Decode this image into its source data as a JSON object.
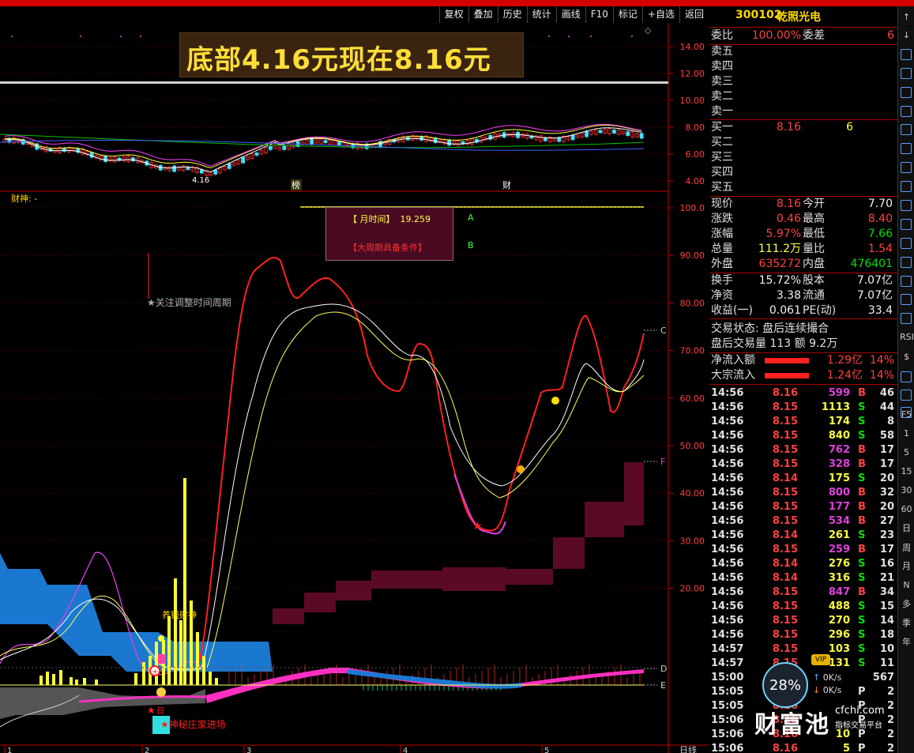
{
  "toolbar": [
    "复权",
    "叠加",
    "历史",
    "统计",
    "画线",
    "F10",
    "标记",
    "+自选",
    "返回"
  ],
  "stock": {
    "code": "300102",
    "name": "乾照光电"
  },
  "banner": "底部4.16元现在8.16元",
  "upper": {
    "yticks": [
      "14.00",
      "12.00",
      "10.00",
      "8.00",
      "6.00",
      "4.00"
    ],
    "low_label": "4.16",
    "tags": [
      "榜",
      "财"
    ]
  },
  "lower": {
    "title": "财神: -",
    "yticks": [
      "100.0",
      "90.00",
      "80.00",
      "70.00",
      "60.00",
      "50.00",
      "40.00",
      "30.00",
      "20.00"
    ],
    "box": {
      "a_label": "【 月时间】",
      "a_value": "19.259",
      "b_label": "【大周期具备条件】",
      "a_tag": "A",
      "b_tag": "B"
    },
    "note": "★关注调整时间周期",
    "right_tags": [
      "C",
      "F",
      "D",
      "E"
    ],
    "jiecai": "养钱财神",
    "zhuangjia": "★神秘庄家进场",
    "ri": "日",
    "xlabels": [
      "1",
      "2",
      "3",
      "4",
      "5"
    ],
    "period": "日线"
  },
  "quote": {
    "weibi_label": "委比",
    "weibi": "100.00%",
    "weicha_label": "委差",
    "weicha": "6",
    "sells": [
      "卖五",
      "卖四",
      "卖三",
      "卖二",
      "卖一"
    ],
    "buys": [
      "买一",
      "买二",
      "买三",
      "买四",
      "买五"
    ],
    "buy1_price": "8.16",
    "buy1_vol": "6",
    "stats": [
      [
        "现价",
        "8.16",
        "今开",
        "7.70"
      ],
      [
        "涨跌",
        "0.46",
        "最高",
        "8.40"
      ],
      [
        "涨幅",
        "5.97%",
        "最低",
        "7.66"
      ],
      [
        "总量",
        "111.2万",
        "量比",
        "1.54"
      ],
      [
        "外盘",
        "635272",
        "内盘",
        "476401"
      ]
    ],
    "stats2": [
      [
        "换手",
        "15.72%",
        "股本",
        "7.07亿"
      ],
      [
        "净资",
        "3.38",
        "流通",
        "7.07亿"
      ],
      [
        "收益(一)",
        "0.061",
        "PE(动)",
        "33.4"
      ]
    ],
    "jiaoyi": "交易状态: 盘后连续撮合",
    "panhou": "盘后交易量 113 额 9.2万",
    "flows": [
      [
        "净流入额",
        "1.29亿",
        "14%"
      ],
      [
        "大宗流入",
        "1.24亿",
        "14%"
      ]
    ]
  },
  "ticks": [
    [
      "14:56",
      "8.16",
      "599",
      "B",
      "46"
    ],
    [
      "14:56",
      "8.15",
      "1113",
      "S",
      "44"
    ],
    [
      "14:56",
      "8.15",
      "174",
      "S",
      "8"
    ],
    [
      "14:56",
      "8.15",
      "840",
      "S",
      "58"
    ],
    [
      "14:56",
      "8.15",
      "762",
      "B",
      "17"
    ],
    [
      "14:56",
      "8.15",
      "328",
      "B",
      "17"
    ],
    [
      "14:56",
      "8.14",
      "175",
      "S",
      "20"
    ],
    [
      "14:56",
      "8.15",
      "800",
      "B",
      "32"
    ],
    [
      "14:56",
      "8.15",
      "177",
      "B",
      "20"
    ],
    [
      "14:56",
      "8.15",
      "534",
      "B",
      "27"
    ],
    [
      "14:56",
      "8.14",
      "261",
      "S",
      "23"
    ],
    [
      "14:56",
      "8.15",
      "259",
      "B",
      "17"
    ],
    [
      "14:56",
      "8.14",
      "276",
      "S",
      "16"
    ],
    [
      "14:56",
      "8.14",
      "316",
      "S",
      "21"
    ],
    [
      "14:56",
      "8.15",
      "847",
      "B",
      "34"
    ],
    [
      "14:56",
      "8.15",
      "488",
      "S",
      "15"
    ],
    [
      "14:56",
      "8.15",
      "270",
      "S",
      "14"
    ],
    [
      "14:56",
      "8.15",
      "296",
      "S",
      "18"
    ],
    [
      "14:57",
      "8.15",
      "103",
      "S",
      "10"
    ],
    [
      "14:57",
      "8.15",
      "131",
      "S",
      "11"
    ],
    [
      "15:00",
      "8.16",
      "",
      "",
      "567"
    ],
    [
      "15:05",
      "8.16",
      "",
      "P",
      "2"
    ],
    [
      "15:05",
      "8.16",
      "",
      "P",
      "2"
    ],
    [
      "15:06",
      "8.16",
      "",
      "P",
      "2"
    ],
    [
      "15:06",
      "8.16",
      "10",
      "P",
      "2"
    ],
    [
      "15:06",
      "8.16",
      "5",
      "P",
      "2"
    ]
  ],
  "side": [
    "↑",
    "↓",
    "",
    "",
    "",
    "",
    "",
    "",
    "",
    "",
    "",
    "",
    "",
    "",
    "",
    "",
    "",
    "RSI",
    "$",
    "",
    "",
    "",
    "F5",
    "1",
    "5",
    "15",
    "30",
    "60",
    "日",
    "周",
    "月",
    "N",
    "多",
    "季",
    "年"
  ],
  "logo": {
    "pct": "28%",
    "up": "0K/s",
    "down": "0K/s",
    "brand": "财富池",
    "site": "cfchi.com",
    "sub": "指标交易平台",
    "vip": "VIP"
  }
}
